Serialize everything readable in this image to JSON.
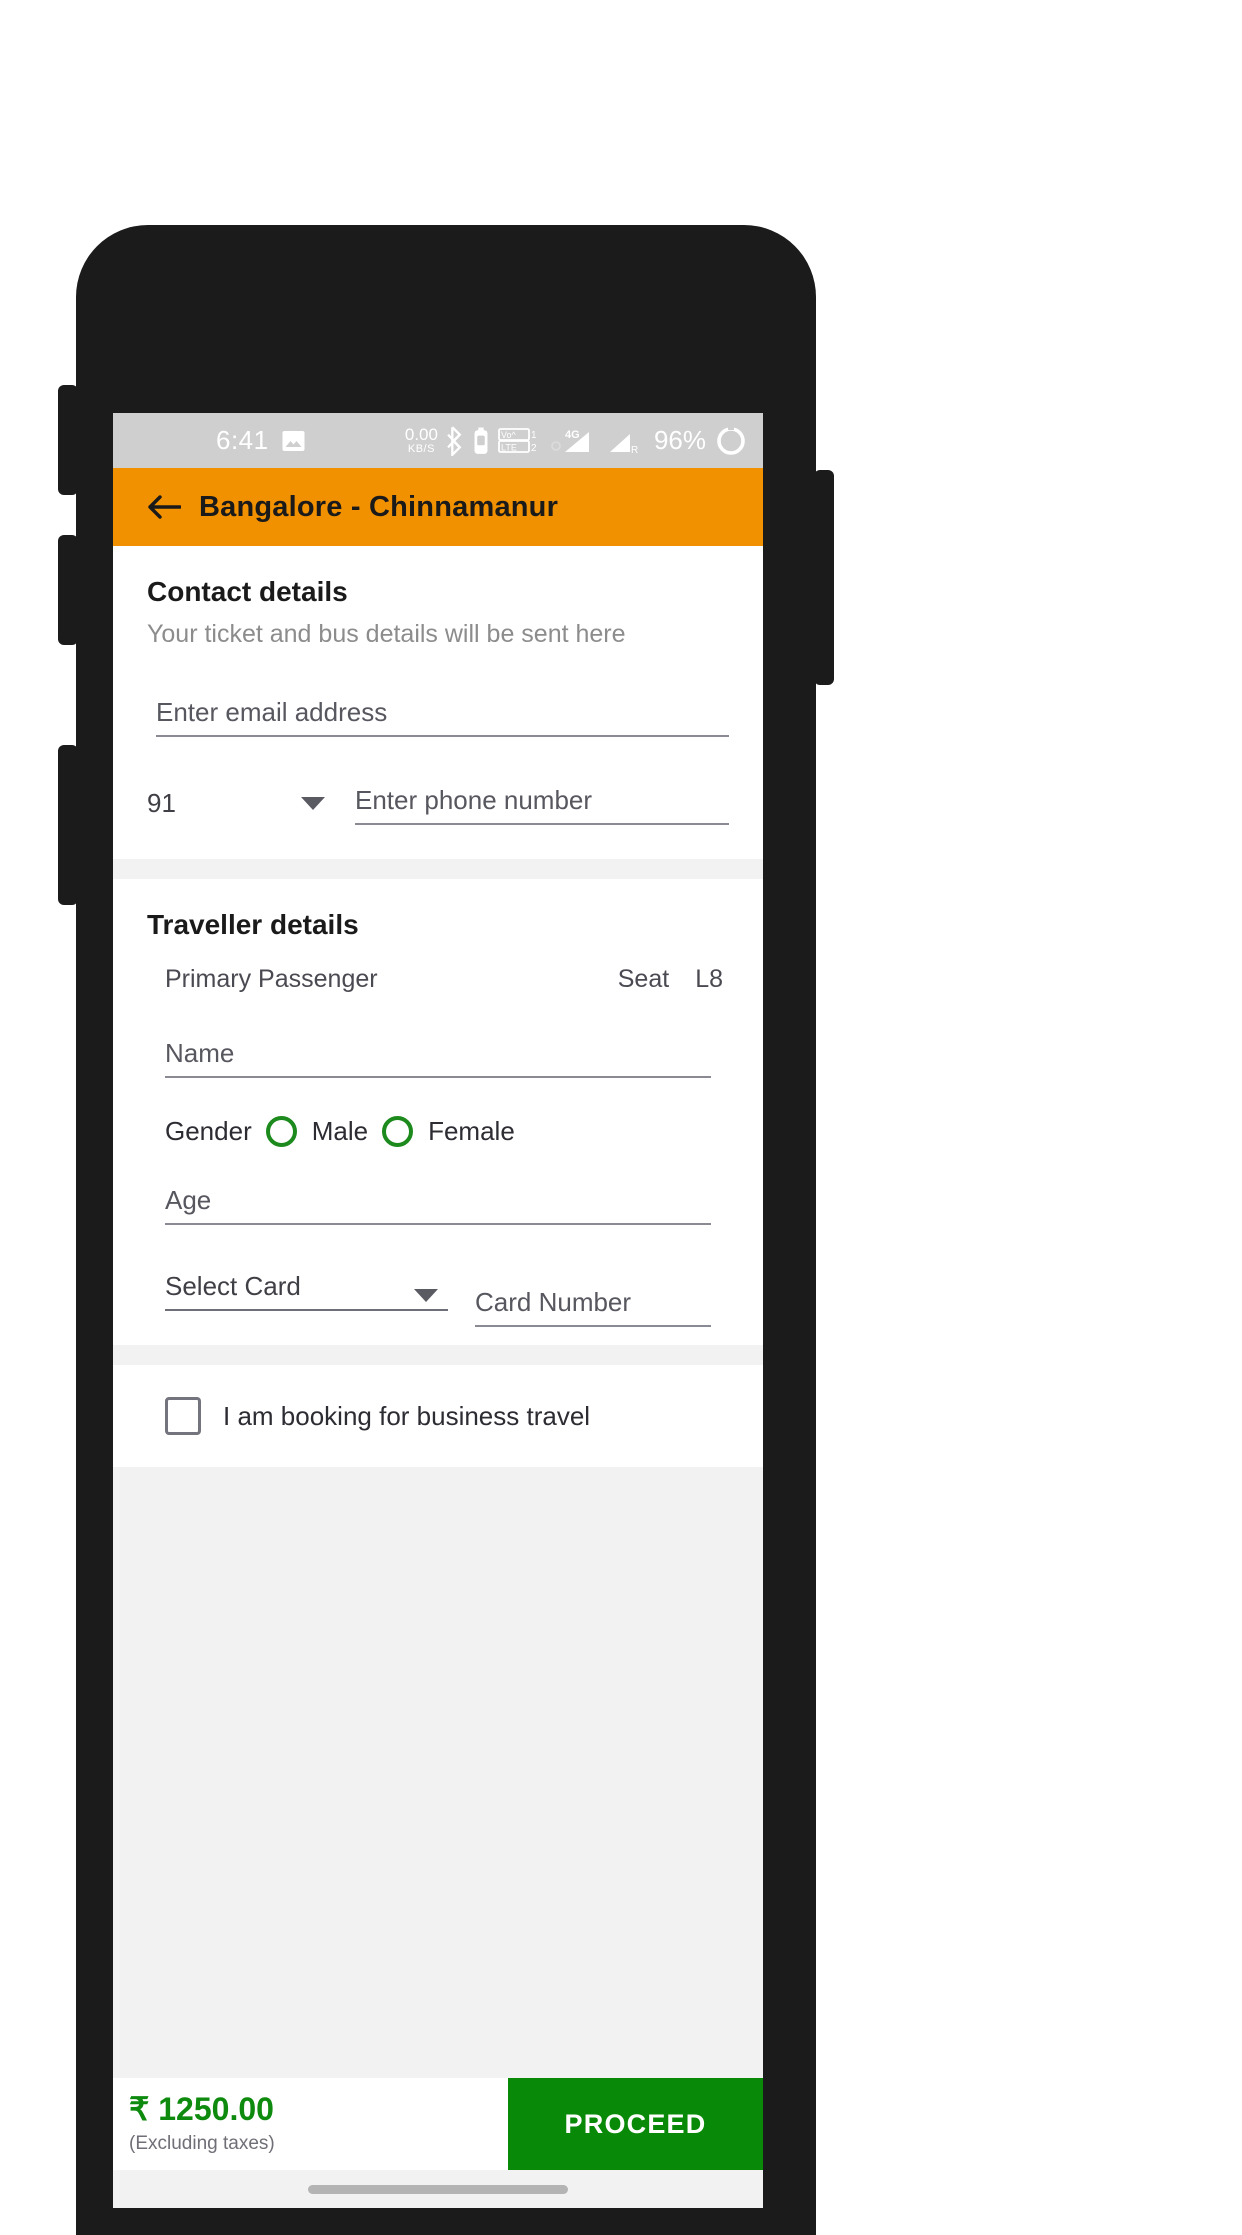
{
  "status_bar": {
    "time": "6:41",
    "screenshot_icon": "image-icon",
    "data_rate": "0.00",
    "data_unit": "KB/S",
    "bluetooth_icon": "bluetooth-icon",
    "volte_icon": "volte-dual-sim-icon",
    "signal_1_label": "4G",
    "signal_2_label": "R",
    "battery_percent": "96%",
    "battery_icon": "battery-circle-icon",
    "bg_color": "#cfcfcf"
  },
  "app_bar": {
    "back_icon": "back-arrow-icon",
    "title": "Bangalore - Chinnamanur",
    "bg_color": "#f29100"
  },
  "contact": {
    "title": "Contact details",
    "subtitle": "Your ticket and bus details will be sent here",
    "email_placeholder": "Enter email address",
    "email_value": "",
    "country_code": "91",
    "country_code_caret": "chevron-down-icon",
    "phone_placeholder": "Enter phone number",
    "phone_value": ""
  },
  "traveller": {
    "title": "Traveller details",
    "passenger_label": "Primary Passenger",
    "seat_label": "Seat",
    "seat_value": "L8",
    "name_placeholder": "Name",
    "name_value": "",
    "gender_label": "Gender",
    "gender_options": [
      "Male",
      "Female"
    ],
    "gender_selected": "",
    "age_placeholder": "Age",
    "age_value": "",
    "card_select_value": "Select Card",
    "card_select_caret": "chevron-down-icon",
    "card_number_placeholder": "Card Number",
    "card_number_value": ""
  },
  "business": {
    "checkbox_checked": false,
    "label": "I am booking for business travel"
  },
  "bottom": {
    "price": "₹ 1250.00",
    "price_note": "(Excluding taxes)",
    "proceed_label": "PROCEED",
    "price_color": "#0e8a0e",
    "button_color": "#088a08"
  }
}
